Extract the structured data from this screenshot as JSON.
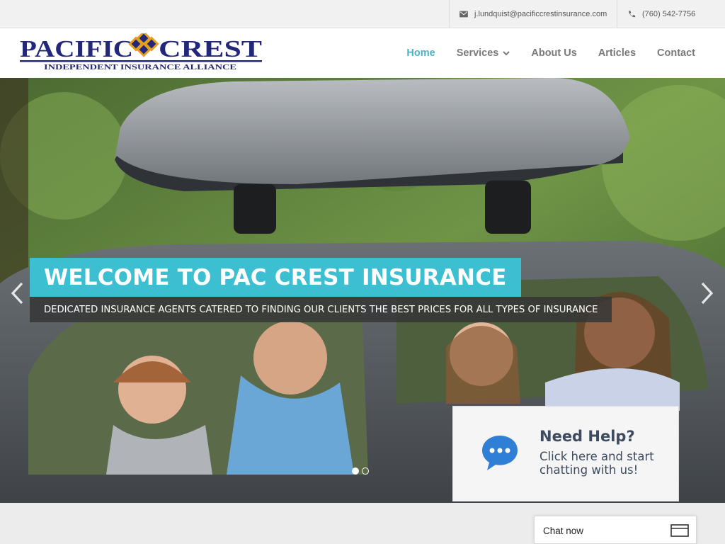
{
  "topbar": {
    "email": "j.lundquist@pacificcrestinsurance.com",
    "phone": "(760) 542-7756"
  },
  "brand": {
    "logo_left": "PACIFIC",
    "logo_right": "CREST",
    "tagline": "INDEPENDENT INSURANCE ALLIANCE",
    "navy": "#23277a",
    "gold": "#e3a020"
  },
  "nav": {
    "items": [
      {
        "label": "Home",
        "active": true
      },
      {
        "label": "Services",
        "dropdown": true
      },
      {
        "label": "About Us"
      },
      {
        "label": "Articles"
      },
      {
        "label": "Contact"
      }
    ]
  },
  "hero": {
    "headline": "WELCOME TO PAC CREST INSURANCE",
    "subline": "DEDICATED INSURANCE AGENTS CATERED TO FINDING OUR CLIENTS THE BEST PRICES FOR ALL TYPES OF INSURANCE",
    "slide_count": 2,
    "active_slide": 1,
    "accent": "#3cbfd0"
  },
  "help": {
    "title": "Need Help?",
    "text": "Click here and start chatting with us!",
    "icon": "chat-bubble-icon",
    "icon_color": "#2f7fd6"
  },
  "chat_widget": {
    "label": "Chat now",
    "icon": "window-icon"
  }
}
